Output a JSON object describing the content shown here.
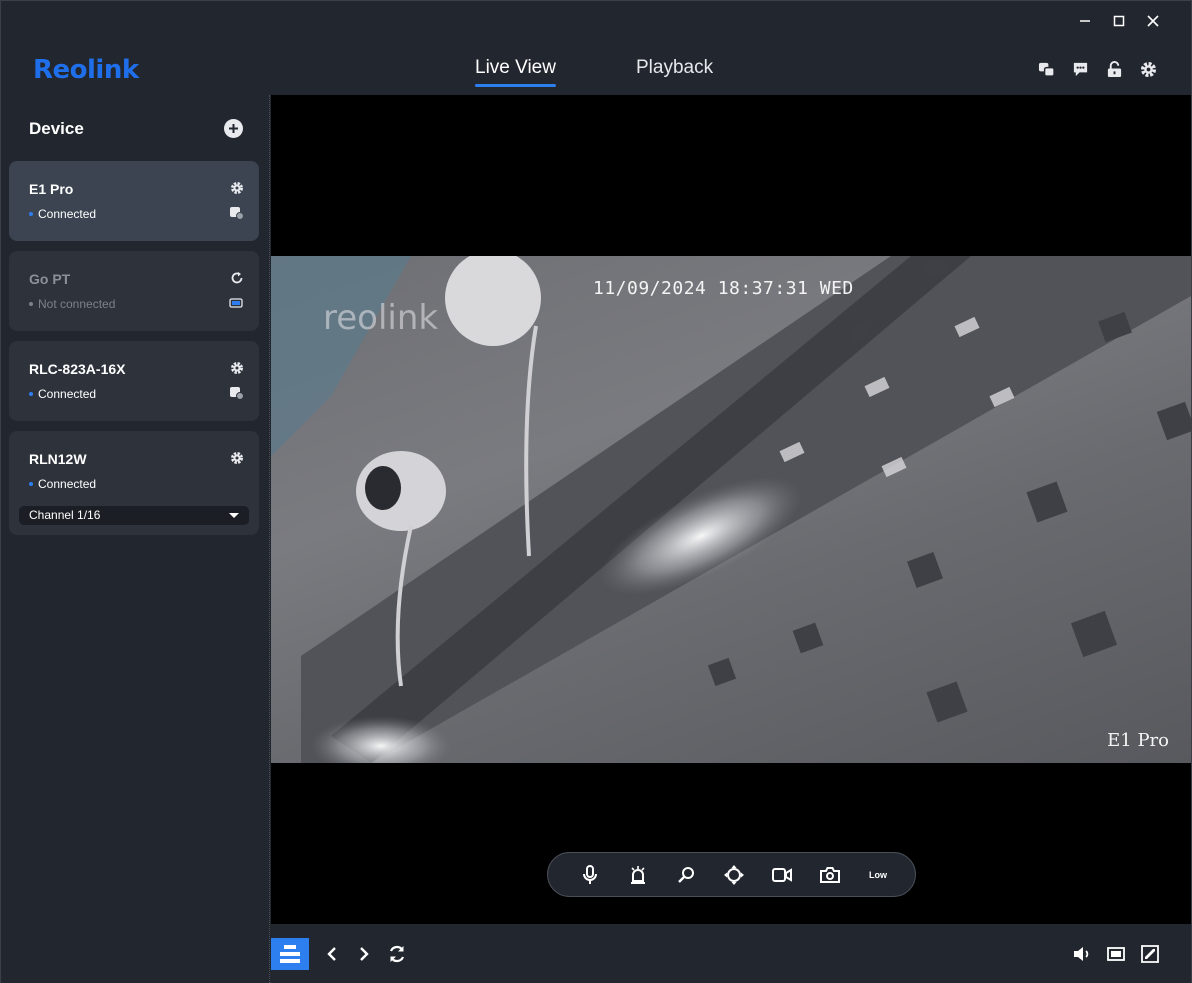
{
  "app": {
    "logo": "Reolink"
  },
  "tabs": [
    {
      "label": "Live View",
      "active": true
    },
    {
      "label": "Playback",
      "active": false
    }
  ],
  "header_icons": [
    "share-icon",
    "chat-icon",
    "unlock-icon",
    "gear-icon"
  ],
  "sidebar": {
    "title": "Device",
    "devices": [
      {
        "name": "E1 Pro",
        "status": "Connected",
        "active": true
      },
      {
        "name": "Go PT",
        "status": "Not connected",
        "active": false
      },
      {
        "name": "RLC-823A-16X",
        "status": "Connected",
        "active": false
      },
      {
        "name": "RLN12W",
        "status": "Connected",
        "active": false,
        "channel": "Channel 1/16"
      }
    ]
  },
  "feed": {
    "timestamp": "11/09/2024 18:37:31 WED",
    "camera_name": "E1 Pro",
    "watermark": "reolink"
  },
  "controls": {
    "quality_label": "Low",
    "icons": [
      "microphone-icon",
      "siren-icon",
      "zoom-icon",
      "ptz-icon",
      "record-icon",
      "snapshot-icon"
    ]
  },
  "bottom_bar": {
    "icons": [
      "layout-icon",
      "previous-icon",
      "next-icon",
      "refresh-icon",
      "volume-icon",
      "aspect-ratio-icon",
      "fullscreen-icon"
    ]
  },
  "colors": {
    "accent": "#2d7ff0",
    "brand": "#1f6feb",
    "background": "#22262e",
    "card": "#2d323b",
    "card_active": "#3b4450"
  }
}
